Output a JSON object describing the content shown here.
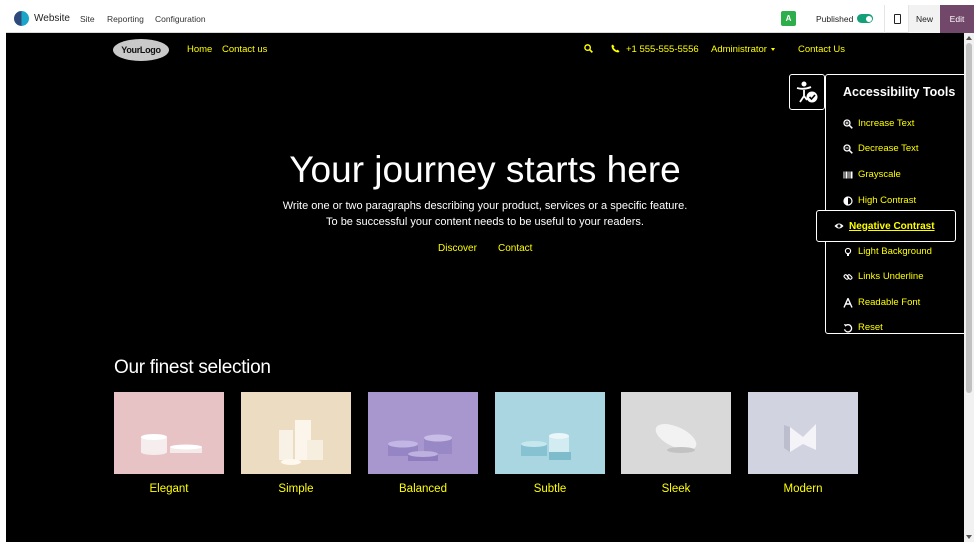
{
  "topbar": {
    "brand": "Website",
    "menus": [
      "Site",
      "Reporting",
      "Configuration"
    ],
    "avatar": "A",
    "published_label": "Published",
    "new_label": "New",
    "edit_label": "Edit"
  },
  "nav": {
    "logo": "YourLogo",
    "links": [
      "Home",
      "Contact us"
    ],
    "phone": "+1 555-555-5556",
    "admin": "Administrator",
    "contact_btn": "Contact Us"
  },
  "hero": {
    "title": "Your journey starts here",
    "line1": "Write one or two paragraphs describing your product, services or a specific feature.",
    "line2": "To be successful your content needs to be useful to your readers.",
    "discover": "Discover",
    "contact": "Contact"
  },
  "selection": {
    "title": "Our finest selection",
    "cards": [
      {
        "label": "Elegant",
        "bg": "#e8c3c5"
      },
      {
        "label": "Simple",
        "bg": "#ecdcc1"
      },
      {
        "label": "Balanced",
        "bg": "#a897cf"
      },
      {
        "label": "Subtle",
        "bg": "#a9d6e0"
      },
      {
        "label": "Sleek",
        "bg": "#d6d6d6"
      },
      {
        "label": "Modern",
        "bg": "#d2d3e0"
      }
    ]
  },
  "accessibility": {
    "title": "Accessibility Tools",
    "items": [
      {
        "label": "Increase Text",
        "icon": "zoom-in-icon"
      },
      {
        "label": "Decrease Text",
        "icon": "zoom-out-icon"
      },
      {
        "label": "Grayscale",
        "icon": "barcode-icon"
      },
      {
        "label": "High Contrast",
        "icon": "contrast-icon"
      },
      {
        "label": "Negative Contrast",
        "icon": "eye-icon"
      },
      {
        "label": "Light Background",
        "icon": "lightbulb-icon"
      },
      {
        "label": "Links Underline",
        "icon": "link-icon"
      },
      {
        "label": "Readable Font",
        "icon": "font-icon"
      },
      {
        "label": "Reset",
        "icon": "reset-icon"
      }
    ]
  },
  "colors": {
    "link": "#ffff00",
    "edit": "#71476a",
    "published": "#13a079"
  }
}
